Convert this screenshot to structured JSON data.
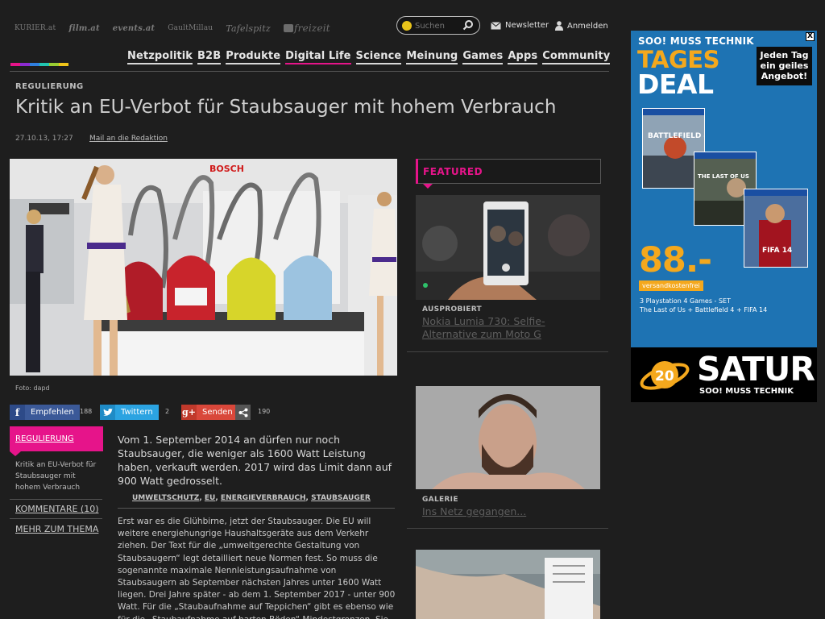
{
  "partners": [
    {
      "label": "KURIER.at"
    },
    {
      "label": "film.at"
    },
    {
      "label": "events.at"
    },
    {
      "label": "GaultMillau"
    },
    {
      "label": "Tafelspitz"
    },
    {
      "label": "freizeit"
    }
  ],
  "search": {
    "placeholder": "Suchen"
  },
  "header_links": {
    "newsletter": "Newsletter",
    "login": "Anmelden"
  },
  "categories": [
    "Netzpolitik",
    "B2B",
    "Produkte",
    "Digital Life",
    "Science",
    "Meinung",
    "Games",
    "Apps",
    "Community"
  ],
  "active_category": "Digital Life",
  "article": {
    "kicker": "REGULIERUNG",
    "title": "Kritik an EU-Verbot für Staubsauger mit hohem Verbrauch",
    "date": "27.10.13, 17:27",
    "mail_link": "Mail an die Redaktion",
    "image_caption": "Foto: dapd",
    "image_brand_text": "BOSCH",
    "lead": "Vom 1. September 2014 an dürfen nur noch Staubsauger, die weniger als 1600 Watt Leistung haben, verkauft werden. 2017 wird das Limit dann auf 900 Watt gedrosselt.",
    "tags": [
      "UMWELTSCHUTZ",
      "EU",
      "ENERGIEVERBRAUCH",
      "STAUBSAUGER"
    ],
    "body": "Erst war es die Glühbirne, jetzt der Staubsauger. Die EU will weitere energiehungrige Haushaltsgeräte aus dem Verkehr ziehen. Der Text für die „umweltgerechte Gestaltung von Staubsaugern“ legt detailliert neue Normen fest. So muss die sogenannte maximale Nennleistungsaufnahme von Staubsaugern ab September nächsten Jahres unter 1600 Watt liegen. Drei Jahre später - ab dem 1. September 2017 - unter 900 Watt. Für die „Staubaufnahme auf Teppichen“ gibt es ebenso wie für die „Staubaufnahme auf harten Böden“ Mindestgrenzen. Sie"
  },
  "share": {
    "facebook_label": "Empfehlen",
    "facebook_count": "188",
    "twitter_label": "Twittern",
    "twitter_count": "2",
    "google_label": "Senden",
    "share_count": "190"
  },
  "sidebar": {
    "tag": "REGULIERUNG",
    "description": "Kritik an EU-Verbot für Staubsauger mit hohem Verbrauch",
    "comments": "KOMMENTARE (10)",
    "more": "MEHR ZUM THEMA"
  },
  "featured": {
    "heading": "FEATURED",
    "items": [
      {
        "kicker": "AUSPROBIERT",
        "title": "Nokia Lumia 730: Selfie-Alternative zum Moto G"
      },
      {
        "kicker": "GALERIE",
        "title": "Ins Netz gegangen..."
      }
    ]
  },
  "ad": {
    "top_text": "SOO! MUSS TECHNIK",
    "tages": "TAGES",
    "deal": "DEAL",
    "bubble": "Jeden Tag ein geiles Angebot!",
    "games": [
      "BATTLEFIELD 4",
      "THE LAST OF US",
      "FIFA 14"
    ],
    "platform": "PS4",
    "price": "88.-",
    "shipping": "versandkostenfrei",
    "line1": "3 Playstation 4 Games - SET",
    "line2": "The Last of Us + Battlefield 4 + FIFA 14",
    "brand": "SATURN",
    "slogan": "SOO! MUSS TECHNIK",
    "close": "X"
  },
  "colors": {
    "accent": "#e6148a",
    "background": "#1e1e1e",
    "facebook": "#3b5998",
    "twitter": "#2ba3e1",
    "google": "#d9473a",
    "ad_blue": "#1e73b3",
    "ad_orange": "#f4a81d"
  }
}
